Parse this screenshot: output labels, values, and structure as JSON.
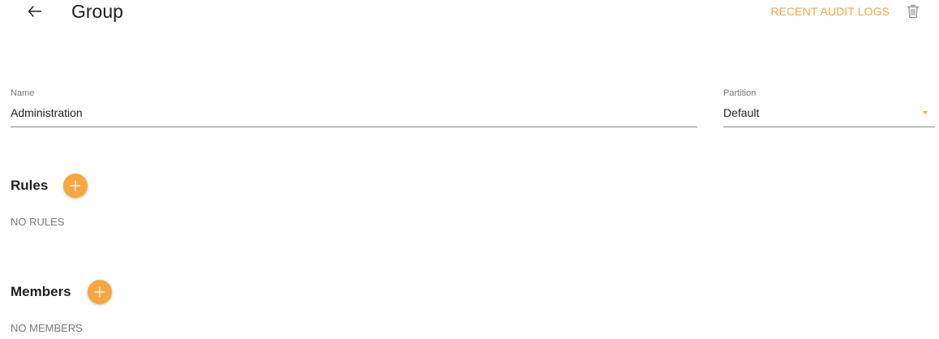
{
  "header": {
    "title": "Group",
    "audit_link_label": "RECENT AUDIT LOGS"
  },
  "form": {
    "name": {
      "label": "Name",
      "value": "Administration"
    },
    "partition": {
      "label": "Partition",
      "value": "Default"
    }
  },
  "rules": {
    "title": "Rules",
    "empty_text": "NO RULES"
  },
  "members": {
    "title": "Members",
    "empty_text": "NO MEMBERS"
  },
  "colors": {
    "accent": "#f6a73f",
    "text": "#212121",
    "muted": "#7a7a7a"
  },
  "icons": {
    "back": "arrow-left-icon",
    "delete": "trash-icon",
    "add": "plus-icon",
    "dropdown": "caret-down-icon"
  }
}
